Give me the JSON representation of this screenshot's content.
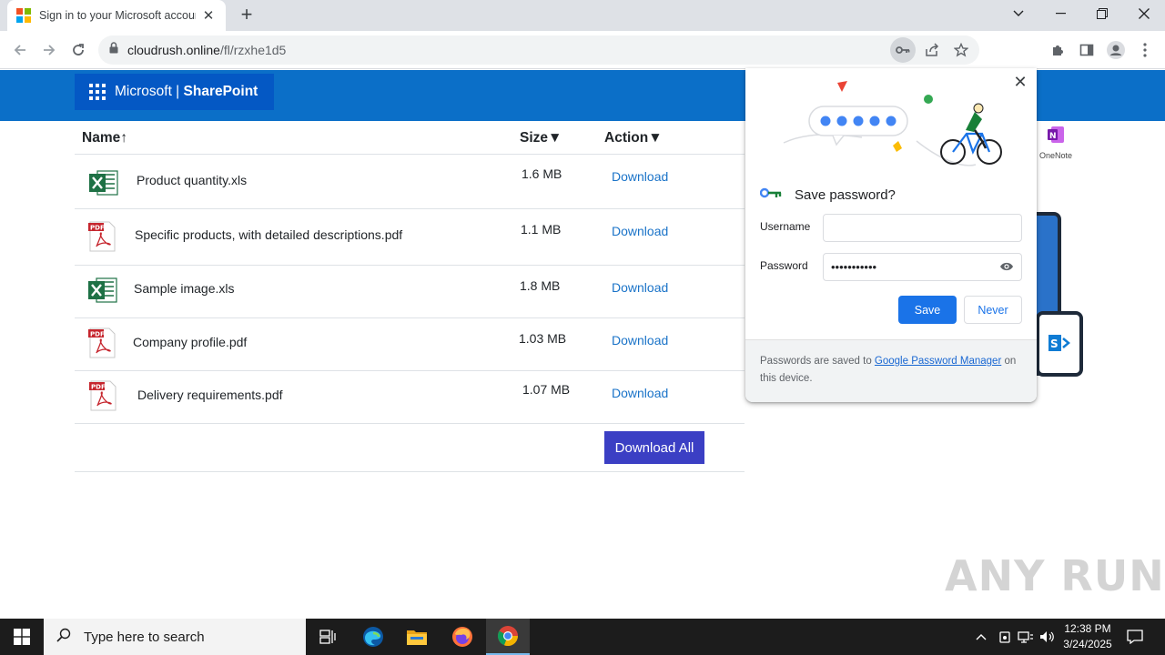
{
  "browser": {
    "tab_title": "Sign in to your Microsoft account",
    "new_tab_symbol": "+",
    "url_host": "cloudrush.online",
    "url_path": "/fl/rzxhe1d5"
  },
  "header": {
    "brand_name": "Microsoft",
    "brand_separator": " | ",
    "brand_product": "SharePoint"
  },
  "table": {
    "columns": [
      {
        "label": "Name↑"
      },
      {
        "label": "Size▼"
      },
      {
        "label": "Action▼"
      }
    ],
    "rows": [
      {
        "name": "Product quantity.xls",
        "size": "1.6 MB",
        "action": "Download",
        "type": "xls-icon"
      },
      {
        "name": "Specific products, with detailed descriptions.pdf",
        "size": "1.1 MB",
        "action": "Download",
        "type": "pdf-icon"
      },
      {
        "name": "Sample image.xls",
        "size": "1.8 MB",
        "action": "Download",
        "type": "xls-icon"
      },
      {
        "name": "Company profile.pdf",
        "size": "1.03 MB",
        "action": "Download",
        "type": "pdf-icon"
      },
      {
        "name": "Delivery requirements.pdf",
        "size": "1.07 MB",
        "action": "Download",
        "type": "pdf-icon"
      }
    ],
    "download_all": "Download All"
  },
  "side_art": {
    "onenote_label": "OneNote"
  },
  "password_popup": {
    "title": "Save password?",
    "username_label": "Username",
    "username_value": "",
    "password_label": "Password",
    "password_value": "•••••••••••",
    "save_label": "Save",
    "never_label": "Never",
    "footer_prefix": "Passwords are saved to ",
    "footer_link": "Google Password Manager",
    "footer_suffix": " on this device."
  },
  "watermark": "ANY RUN",
  "taskbar": {
    "search_placeholder": "Type here to search",
    "time": "12:38 PM",
    "date": "3/24/2025"
  },
  "colors": {
    "header_blue": "#0b6fc8",
    "download_all_bg": "#3b3fc4",
    "link_blue": "#1a73c8",
    "chrome_blue": "#1a73e8"
  }
}
